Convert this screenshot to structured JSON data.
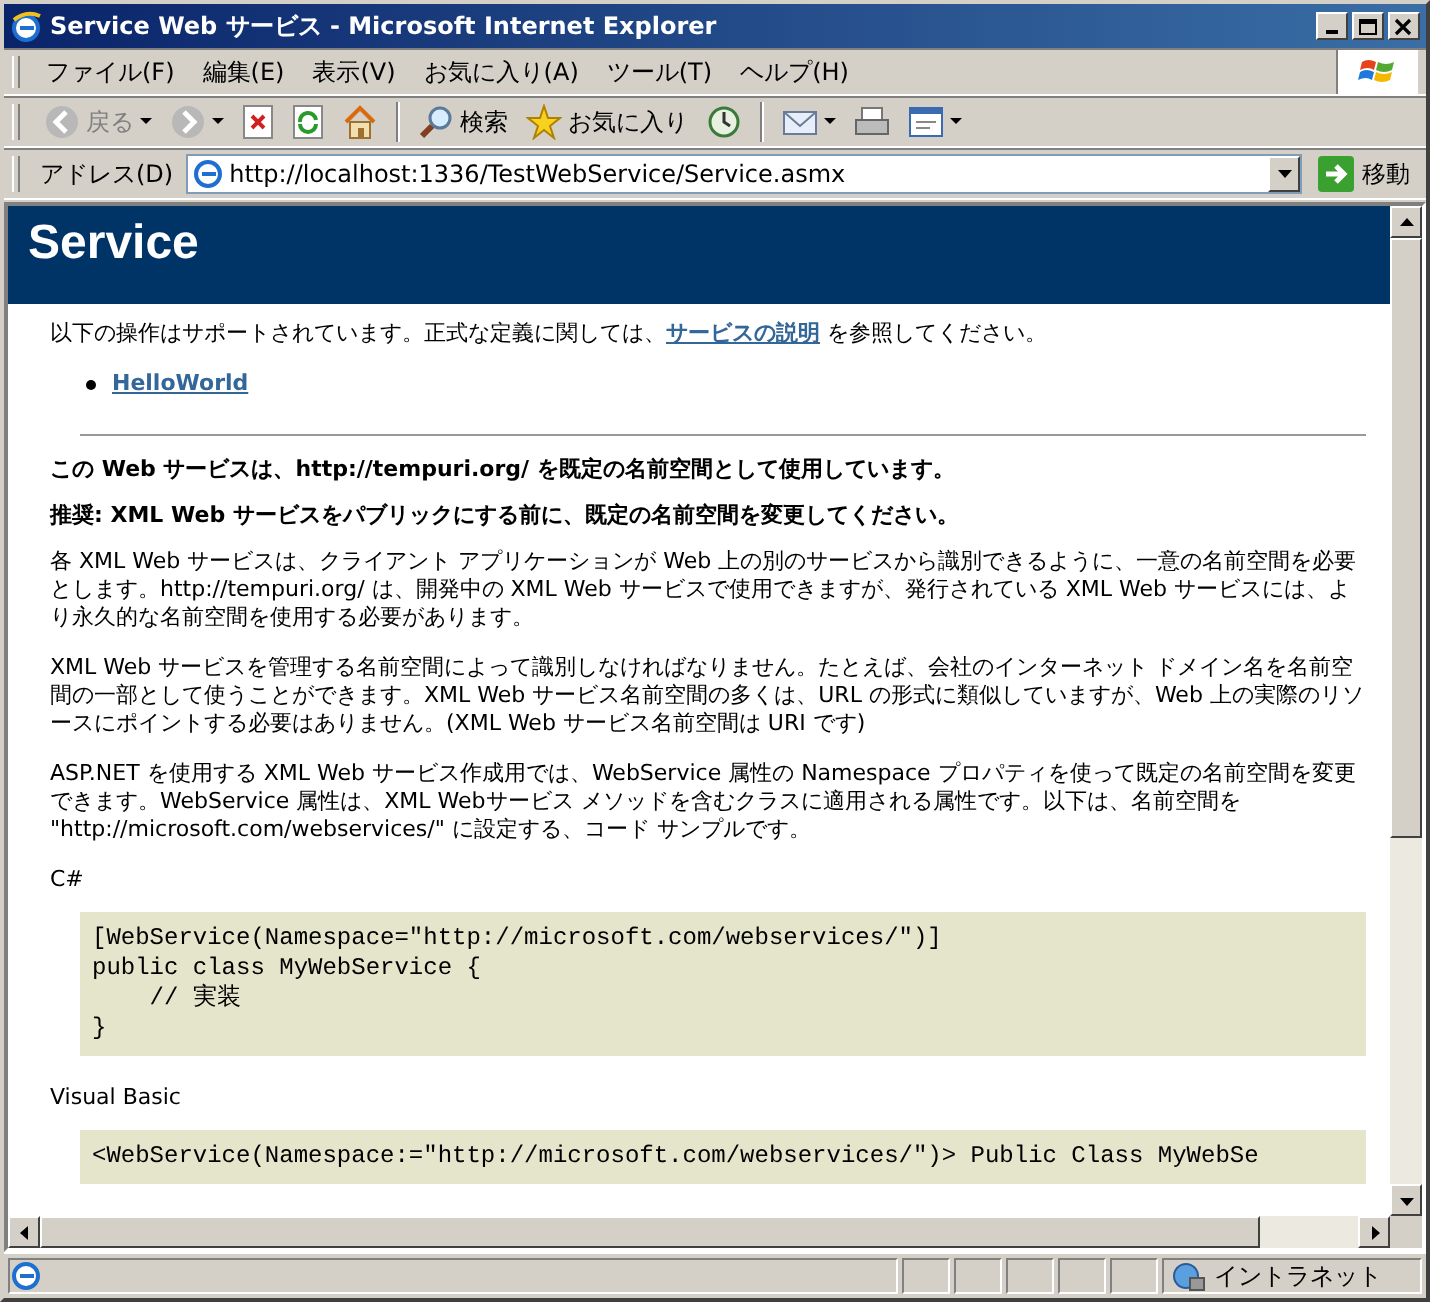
{
  "window": {
    "title": "Service Web サービス - Microsoft Internet Explorer"
  },
  "menu": [
    "ファイル(F)",
    "編集(E)",
    "表示(V)",
    "お気に入り(A)",
    "ツール(T)",
    "ヘルプ(H)"
  ],
  "toolbar": {
    "back": "戻る",
    "search": "検索",
    "favorites": "お気に入り"
  },
  "address": {
    "label": "アドレス(D)",
    "url": "http://localhost:1336/TestWebService/Service.asmx",
    "go": "移動"
  },
  "page": {
    "heading": "Service",
    "intro": {
      "before": "以下の操作はサポートされています。正式な定義に関しては、",
      "link": "サービスの説明",
      "after": " を参照してください。"
    },
    "operations": [
      "HelloWorld"
    ],
    "notice": "この Web サービスは、http://tempuri.org/ を既定の名前空間として使用しています。",
    "recommend": "推奨: XML Web サービスをパブリックにする前に、既定の名前空間を変更してください。",
    "paragraphs": [
      "各 XML Web サービスは、クライアント アプリケーションが Web 上の別のサービスから識別できるように、一意の名前空間を必要とします。http://tempuri.org/ は、開発中の XML Web サービスで使用できますが、発行されている XML Web サービスには、より永久的な名前空間を使用する必要があります。",
      "XML Web サービスを管理する名前空間によって識別しなければなりません。たとえば、会社のインターネット ドメイン名を名前空間の一部として使うことができます。XML Web サービス名前空間の多くは、URL の形式に類似していますが、Web 上の実際のリソースにポイントする必要はありません。(XML Web サービス名前空間は URI です)",
      "ASP.NET を使用する XML Web サービス作成用では、WebService 属性の Namespace プロパティを使って既定の名前空間を変更できます。WebService 属性は、XML Webサービス メソッドを含むクラスに適用される属性です。以下は、名前空間を \"http://microsoft.com/webservices/\" に設定する、コード サンプルです。"
    ],
    "samples": [
      {
        "language": "C#",
        "code": "[WebService(Namespace=\"http://microsoft.com/webservices/\")]\npublic class MyWebService {\n    // 実装\n}"
      },
      {
        "language": "Visual Basic",
        "code": "<WebService(Namespace:=\"http://microsoft.com/webservices/\")> Public Class MyWebSe"
      }
    ]
  },
  "status": {
    "zone": "イントラネット"
  }
}
